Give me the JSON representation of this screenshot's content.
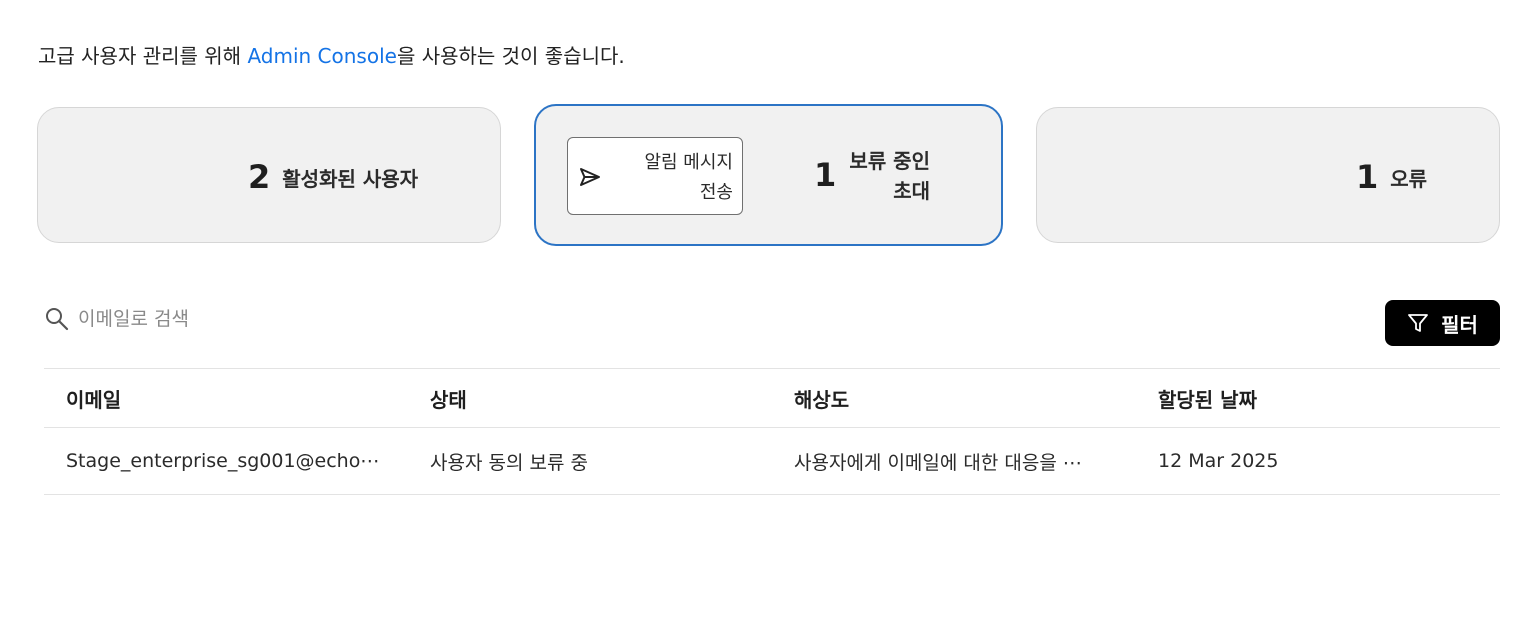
{
  "intro": {
    "before": "고급 사용자 관리를 위해 ",
    "link": "Admin Console",
    "after": "을 사용하는 것이 좋습니다."
  },
  "cards": {
    "active": {
      "count": "2",
      "label": "활성화된 사용자"
    },
    "pending": {
      "notify_button": {
        "line1": "알림 메시지",
        "line2": "전송",
        "icon": "send-icon"
      },
      "count": "1",
      "label_line1": "보류 중인",
      "label_line2": "초대"
    },
    "error": {
      "count": "1",
      "label": "오류"
    }
  },
  "search": {
    "placeholder": "이메일로 검색",
    "value": "",
    "icon": "search-icon"
  },
  "filter": {
    "label": "필터",
    "icon": "filter-icon"
  },
  "table": {
    "headers": [
      "이메일",
      "상태",
      "해상도",
      "할당된 날짜"
    ],
    "rows": [
      [
        "Stage_enterprise_sg001@echo⋯",
        "사용자 동의 보류 중",
        "사용자에게 이메일에 대한 대응을 ⋯",
        "12 Mar 2025"
      ]
    ]
  },
  "colors": {
    "accent": "#1473e6",
    "selected_border": "#2c74c5",
    "card_bg": "#f1f1f1",
    "filter_bg": "#000000"
  }
}
